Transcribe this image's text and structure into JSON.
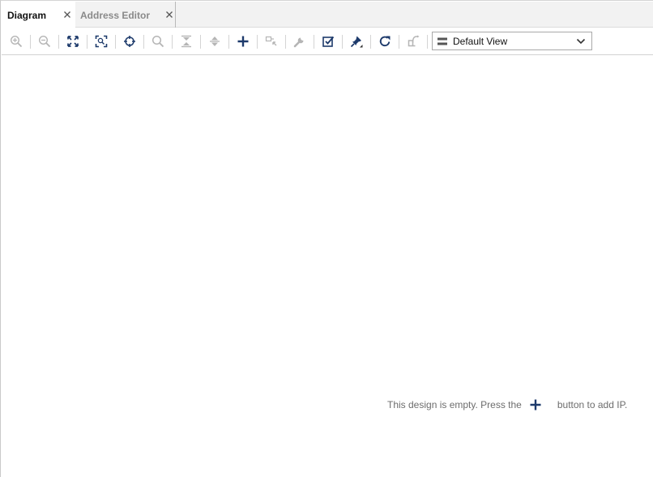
{
  "tabs": [
    {
      "label": "Diagram",
      "active": true
    },
    {
      "label": "Address Editor",
      "active": false
    }
  ],
  "toolbar": {
    "buttons": [
      {
        "icon": "zoom-in-icon",
        "enabled": false
      },
      {
        "icon": "zoom-out-icon",
        "enabled": false
      },
      {
        "icon": "zoom-fit-icon",
        "enabled": true
      },
      {
        "icon": "zoom-area-icon",
        "enabled": true
      },
      {
        "icon": "crosshair-icon",
        "enabled": true
      },
      {
        "icon": "search-icon",
        "enabled": false
      },
      {
        "icon": "collapse-all-icon",
        "enabled": false
      },
      {
        "icon": "expand-all-icon",
        "enabled": false
      },
      {
        "icon": "add-ip-icon",
        "enabled": true
      },
      {
        "icon": "make-connection-icon",
        "enabled": false
      },
      {
        "icon": "wrench-icon",
        "enabled": false
      },
      {
        "icon": "validate-design-icon",
        "enabled": true
      },
      {
        "icon": "pin-icon",
        "enabled": true
      },
      {
        "icon": "refresh-icon",
        "enabled": true
      },
      {
        "icon": "regenerate-layout-icon",
        "enabled": false
      }
    ],
    "view_select": {
      "value": "Default View"
    }
  },
  "canvas": {
    "hint_before": "This design is empty. Press the",
    "hint_after": "button to add IP."
  },
  "colors": {
    "icon_active": "#1d3a6b",
    "icon_disabled": "#b5b5b5",
    "hint_text": "#6d6d6d",
    "tab_strip": "#f2f2f2"
  }
}
